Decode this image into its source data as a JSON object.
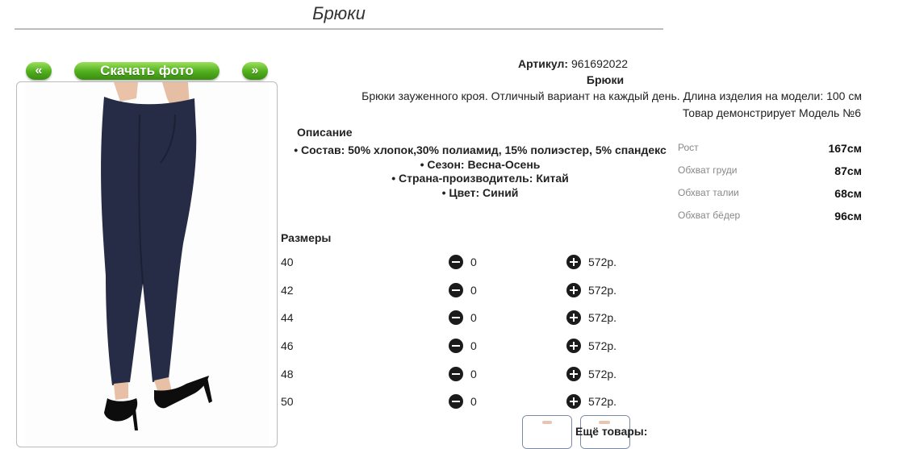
{
  "page": {
    "title": "Брюки"
  },
  "gallery": {
    "prev_label": "«",
    "download_label": "Скачать фото",
    "next_label": "»"
  },
  "product": {
    "artikul_label": "Артикул:",
    "artikul_value": "961692022",
    "name": "Брюки",
    "description": "Брюки зауженного кроя. Отличный вариант на каждый день. Длина изделия на модели: 100 см",
    "model_note": "Товар демонстрирует Модель №6"
  },
  "description_section": {
    "heading": "Описание",
    "items": [
      "• Состав: 50% хлопок,30% полиамид, 15% полиэстер, 5% спандекс",
      "• Сезон: Весна-Осень",
      "• Страна-производитель: Китай",
      "• Цвет: Синий"
    ]
  },
  "model_measurements": [
    {
      "label": "Рост",
      "value": "167см"
    },
    {
      "label": "Обхват груди",
      "value": "87см"
    },
    {
      "label": "Обхват талии",
      "value": "68см"
    },
    {
      "label": "Обхват бёдер",
      "value": "96см"
    }
  ],
  "sizes": {
    "heading": "Размеры",
    "rows": [
      {
        "size": "40",
        "qty": "0",
        "price": "572р."
      },
      {
        "size": "42",
        "qty": "0",
        "price": "572р."
      },
      {
        "size": "44",
        "qty": "0",
        "price": "572р."
      },
      {
        "size": "46",
        "qty": "0",
        "price": "572р."
      },
      {
        "size": "48",
        "qty": "0",
        "price": "572р."
      },
      {
        "size": "50",
        "qty": "0",
        "price": "572р."
      }
    ]
  },
  "more_goods_label": "Ещё товары:",
  "colors": {
    "button_green": "#4fae1c",
    "pants_navy": "#262c45"
  }
}
